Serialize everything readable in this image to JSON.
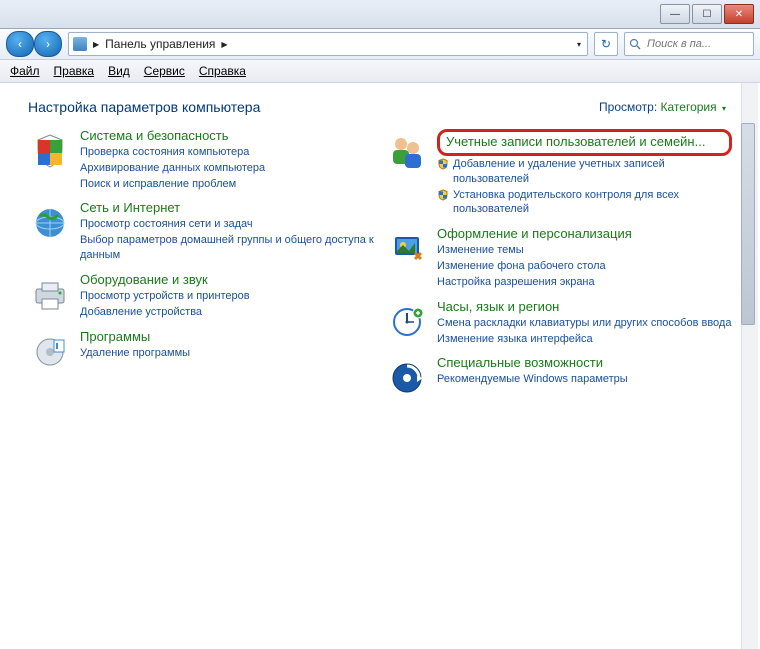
{
  "title_buttons": {
    "min": "—",
    "max": "☐",
    "close": "✕"
  },
  "nav": {
    "back": "‹",
    "fwd": "›",
    "addr_sep": "▶",
    "addr_label": "Панель управления",
    "search_placeholder": "Поиск в па...",
    "refresh": "↻",
    "dropdown": "▾"
  },
  "menu": {
    "file": "Файл",
    "edit": "Правка",
    "view": "Вид",
    "tools": "Сервис",
    "help": "Справка"
  },
  "header": {
    "title": "Настройка параметров компьютера",
    "view_label": "Просмотр:",
    "view_value": "Категория",
    "view_chev": "▾"
  },
  "left": [
    {
      "t": "Система и безопасность",
      "l": [
        "Проверка состояния компьютера",
        "Архивирование данных компьютера",
        "Поиск и исправление проблем"
      ]
    },
    {
      "t": "Сеть и Интернет",
      "l": [
        "Просмотр состояния сети и задач",
        "Выбор параметров домашней группы и общего доступа к данным"
      ]
    },
    {
      "t": "Оборудование и звук",
      "l": [
        "Просмотр устройств и принтеров",
        "Добавление устройства"
      ]
    },
    {
      "t": "Программы",
      "l": [
        "Удаление программы"
      ]
    }
  ],
  "right": [
    {
      "t": "Учетные записи пользователей и семейн...",
      "hl": true,
      "l": [
        {
          "s": true,
          "t": "Добавление и удаление учетных записей пользователей"
        },
        {
          "s": true,
          "t": "Установка родительского контроля для всех пользователей"
        }
      ]
    },
    {
      "t": "Оформление и персонализация",
      "l": [
        {
          "t": "Изменение темы"
        },
        {
          "t": "Изменение фона рабочего стола"
        },
        {
          "t": "Настройка разрешения экрана"
        }
      ]
    },
    {
      "t": "Часы, язык и регион",
      "l": [
        {
          "t": "Смена раскладки клавиатуры или других способов ввода"
        },
        {
          "t": "Изменение языка интерфейса"
        }
      ]
    },
    {
      "t": "Специальные возможности",
      "l": [
        {
          "t": "Рекомендуемые Windows параметры"
        }
      ]
    }
  ]
}
